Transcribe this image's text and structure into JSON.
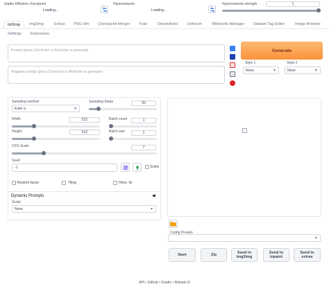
{
  "top": {
    "checkpoint": {
      "label": "Stable Diffusion checkpoint",
      "value": "Loading..."
    },
    "hypernetwork": {
      "label": "Hypernetwork",
      "value": "Loading..."
    },
    "hypernetwork_strength": {
      "label": "Hypernetwork strength",
      "value": "1"
    }
  },
  "tabs": {
    "row1": [
      "txt2img",
      "img2img",
      "Extras",
      "PNG Info",
      "Checkpoint Merger",
      "Train",
      "DreamArtist",
      "Deforum",
      "Wildcards Manager",
      "Dataset Tag Editor",
      "Image Browser"
    ],
    "row2": [
      "Settings",
      "Extensions"
    ],
    "active": "txt2img"
  },
  "prompt": {
    "placeholder": "Prompt (press Ctrl+Enter or Alt+Enter to generate)"
  },
  "negative_prompt": {
    "placeholder": "Negative prompt (press Ctrl+Enter or Alt+Enter to generate)"
  },
  "generate": {
    "label": "Generate",
    "color": "#fb923c"
  },
  "styles": {
    "style1": {
      "label": "Style 1",
      "value": "None"
    },
    "style2": {
      "label": "Style 2",
      "value": "None"
    }
  },
  "params": {
    "sampling_method": {
      "label": "Sampling method",
      "value": "Euler a"
    },
    "sampling_steps": {
      "label": "Sampling Steps",
      "value": "20",
      "fraction": 0.13
    },
    "width": {
      "label": "Width",
      "value": "512",
      "fraction": 0.25
    },
    "height": {
      "label": "Height",
      "value": "512",
      "fraction": 0.25
    },
    "batch_count": {
      "label": "Batch count",
      "value": "1",
      "fraction": 0.0
    },
    "batch_size": {
      "label": "Batch size",
      "value": "1",
      "fraction": 0.0
    },
    "cfg_scale": {
      "label": "CFG Scale",
      "value": "7",
      "fraction": 0.23
    },
    "seed": {
      "label": "Seed",
      "value": "-1"
    },
    "extra": "Extra",
    "restore_faces": "Restore faces",
    "tiling": "Tiling",
    "hires_fix": "Hires. fix"
  },
  "dynamic_prompts": {
    "title": "Dynamic Prompts",
    "script_label": "Script",
    "script_value": "None"
  },
  "output": {
    "config_presets_label": "Config Presets",
    "buttons": [
      "Save",
      "Zip",
      "Send to img2img",
      "Send to inpaint",
      "Send to extras"
    ]
  },
  "footer": {
    "links": [
      "API",
      "Github",
      "Gradio",
      "Reload UI"
    ],
    "separator": "•"
  }
}
